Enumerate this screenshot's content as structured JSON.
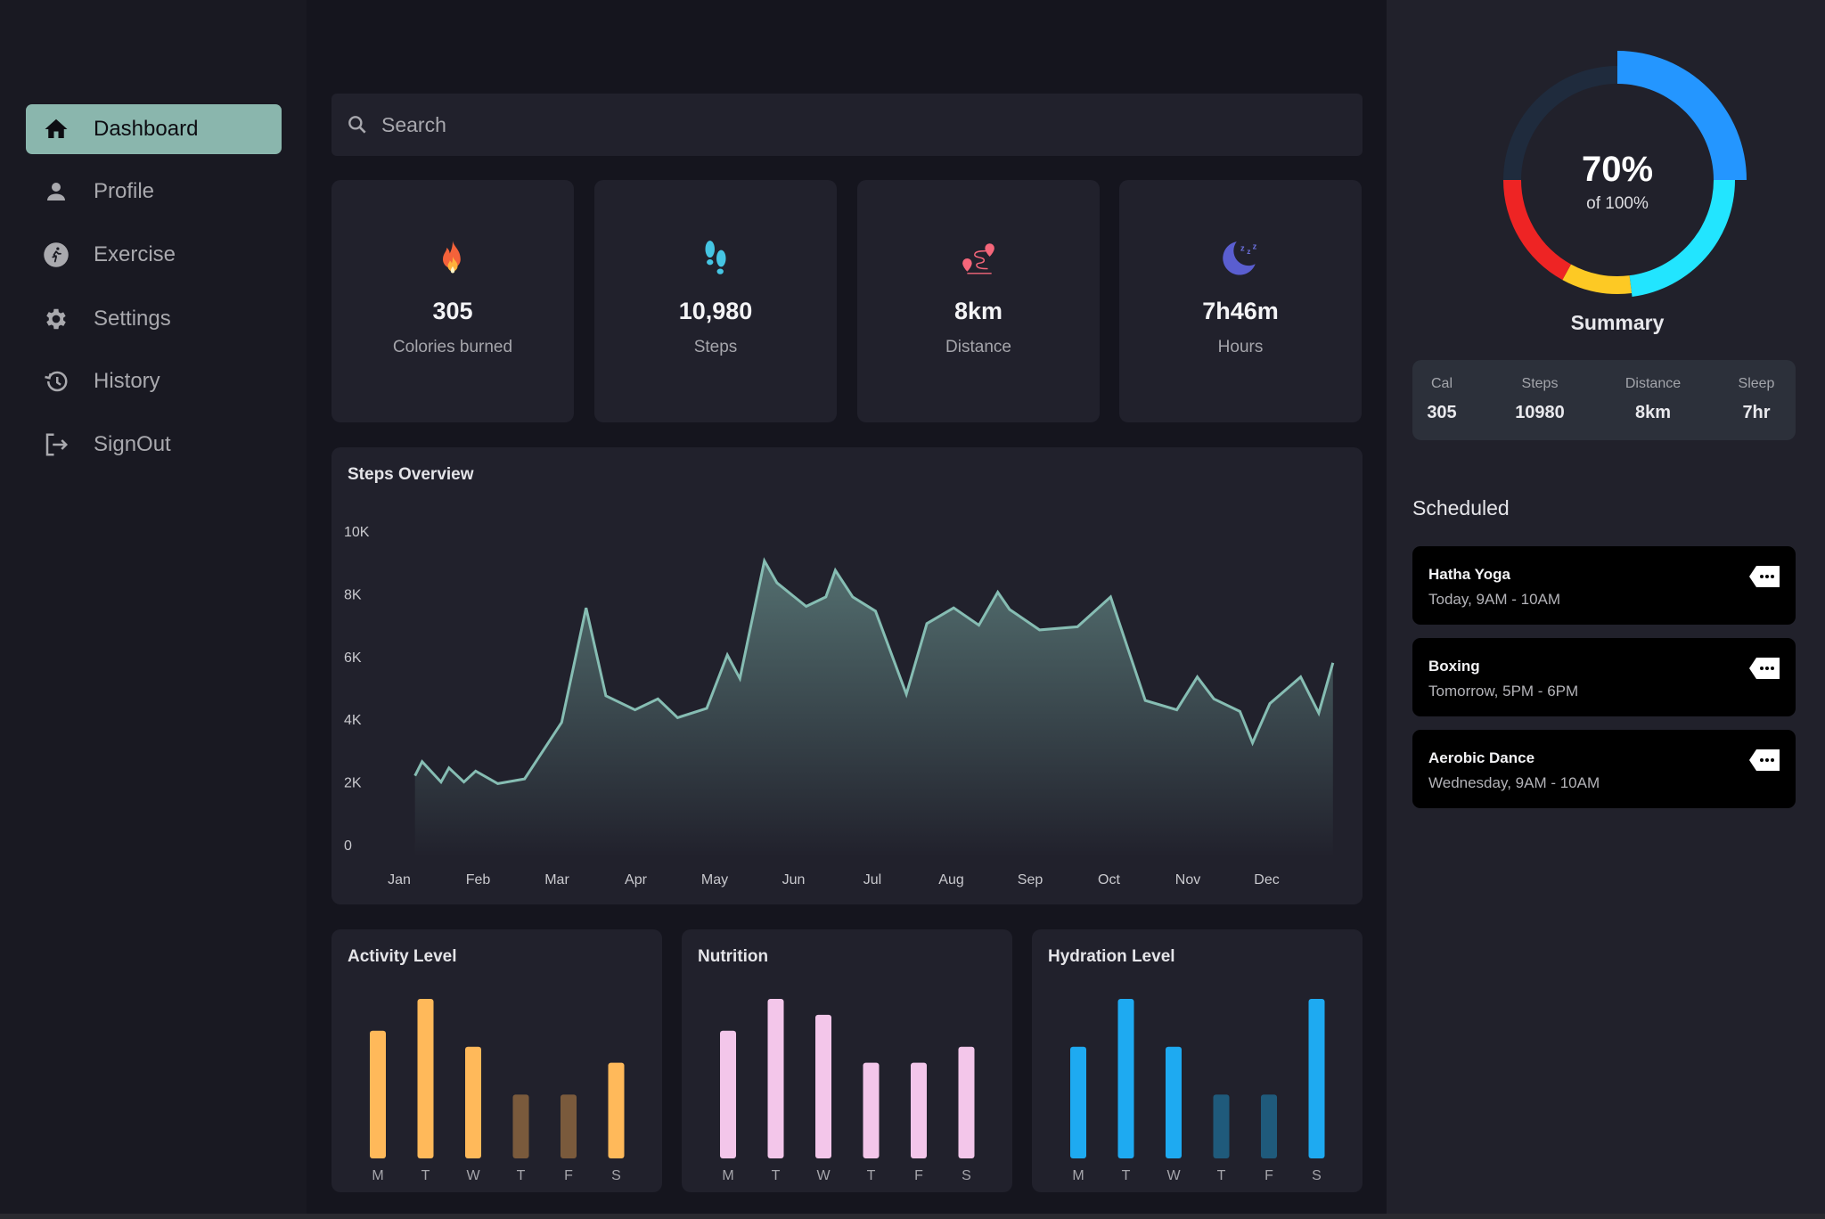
{
  "sidebar": {
    "items": [
      {
        "label": "Dashboard",
        "icon": "home-icon",
        "active": true
      },
      {
        "label": "Profile",
        "icon": "person-icon",
        "active": false
      },
      {
        "label": "Exercise",
        "icon": "running-icon",
        "active": false
      },
      {
        "label": "Settings",
        "icon": "gear-icon",
        "active": false
      },
      {
        "label": "History",
        "icon": "history-icon",
        "active": false
      },
      {
        "label": "SignOut",
        "icon": "logout-icon",
        "active": false
      }
    ],
    "accent": "#8ab6ad"
  },
  "search": {
    "placeholder": "Search",
    "value": ""
  },
  "stats": [
    {
      "icon": "fire-icon",
      "value": "305",
      "label": "Colories burned"
    },
    {
      "icon": "footprints-icon",
      "value": "10,980",
      "label": "Steps"
    },
    {
      "icon": "route-icon",
      "value": "8km",
      "label": "Distance"
    },
    {
      "icon": "moon-sleep-icon",
      "value": "7h46m",
      "label": "Hours"
    }
  ],
  "steps_overview": {
    "title": "Steps Overview"
  },
  "activity": {
    "title": "Activity Level"
  },
  "nutrition": {
    "title": "Nutrition"
  },
  "hydration": {
    "title": "Hydration Level"
  },
  "chart_data": [
    {
      "type": "area",
      "title": "Steps Overview",
      "xlabel": "",
      "ylabel": "",
      "ylim": [
        0,
        10000
      ],
      "yticks": [
        0,
        2000,
        4000,
        6000,
        8000,
        10000
      ],
      "ytick_labels": [
        "0",
        "2K",
        "4K",
        "6K",
        "8K",
        "10K"
      ],
      "categories": [
        "Jan",
        "Feb",
        "Mar",
        "Apr",
        "May",
        "Jun",
        "Jul",
        "Aug",
        "Sep",
        "Oct",
        "Nov",
        "Dec"
      ],
      "grid": false,
      "color": "#86bdb3",
      "x_range_months": [
        0.2,
        11.9
      ],
      "series": [
        {
          "name": "Steps",
          "x": [
            0.2,
            0.29,
            0.53,
            0.63,
            0.82,
            0.97,
            1.25,
            1.59,
            2.06,
            2.37,
            2.62,
            2.99,
            3.28,
            3.53,
            3.9,
            4.16,
            4.32,
            4.63,
            4.79,
            5.16,
            5.41,
            5.53,
            5.75,
            6.04,
            6.43,
            6.69,
            7.03,
            7.35,
            7.59,
            7.74,
            8.12,
            8.6,
            9.02,
            9.46,
            9.86,
            10.12,
            10.33,
            10.66,
            10.82,
            11.04,
            11.43,
            11.66,
            11.84
          ],
          "values": [
            2200,
            2650,
            2000,
            2450,
            2000,
            2350,
            1950,
            2100,
            3900,
            7550,
            4750,
            4300,
            4650,
            4050,
            4350,
            6050,
            5300,
            9050,
            8350,
            7600,
            7900,
            8750,
            7900,
            7450,
            4800,
            7050,
            7550,
            7000,
            8050,
            7500,
            6850,
            6950,
            7900,
            4600,
            4300,
            5350,
            4650,
            4250,
            3250,
            4500,
            5350,
            4200,
            5800
          ]
        }
      ]
    },
    {
      "type": "bar",
      "title": "Activity Level",
      "categories": [
        "M",
        "T",
        "W",
        "T",
        "F",
        "S"
      ],
      "values": [
        80,
        100,
        70,
        40,
        40,
        60
      ],
      "ylim": [
        0,
        100
      ],
      "colors": [
        "#ffb95a",
        "#ffb95a",
        "#ffb95a",
        "#7a5a3c",
        "#7a5a3c",
        "#ffb95a"
      ]
    },
    {
      "type": "bar",
      "title": "Nutrition",
      "categories": [
        "M",
        "T",
        "W",
        "T",
        "F",
        "S"
      ],
      "values": [
        80,
        100,
        90,
        60,
        60,
        70
      ],
      "ylim": [
        0,
        100
      ],
      "colors": [
        "#f3c6ea",
        "#f3c6ea",
        "#f3c6ea",
        "#f3c6ea",
        "#f3c6ea",
        "#f3c6ea"
      ]
    },
    {
      "type": "bar",
      "title": "Hydration Level",
      "categories": [
        "M",
        "T",
        "W",
        "T",
        "F",
        "S"
      ],
      "values": [
        70,
        100,
        70,
        40,
        40,
        100
      ],
      "ylim": [
        0,
        100
      ],
      "colors": [
        "#1eaaf1",
        "#1eaaf1",
        "#1eaaf1",
        "#1f5a7b",
        "#1f5a7b",
        "#1eaaf1"
      ]
    },
    {
      "type": "pie",
      "title": "Summary",
      "center_label": "70%",
      "center_sublabel": "of 100%",
      "segments": [
        {
          "name": "blue",
          "value": 25,
          "color": "#2496ff"
        },
        {
          "name": "cyan",
          "value": 23,
          "color": "#22e5ff"
        },
        {
          "name": "yellow",
          "value": 10,
          "color": "#fdc924"
        },
        {
          "name": "red",
          "value": 17,
          "color": "#ee2424"
        },
        {
          "name": "remaining",
          "value": 25,
          "color": "#1f2b3d"
        }
      ]
    }
  ],
  "summary": {
    "percent": "70%",
    "of_label": "of 100%",
    "title": "Summary",
    "columns": [
      {
        "key": "Cal",
        "value": "305"
      },
      {
        "key": "Steps",
        "value": "10980"
      },
      {
        "key": "Distance",
        "value": "8km"
      },
      {
        "key": "Sleep",
        "value": "7hr"
      }
    ]
  },
  "scheduled": {
    "title": "Scheduled",
    "items": [
      {
        "name": "Hatha Yoga",
        "time": "Today, 9AM - 10AM"
      },
      {
        "name": "Boxing",
        "time": "Tomorrow, 5PM - 6PM"
      },
      {
        "name": "Aerobic Dance",
        "time": "Wednesday, 9AM - 10AM"
      }
    ]
  }
}
